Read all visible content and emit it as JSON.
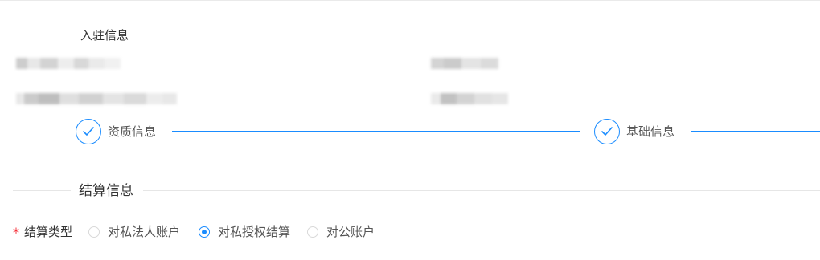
{
  "section_basic": {
    "title": "入驻信息"
  },
  "steps": [
    {
      "label": "资质信息",
      "state": "done",
      "icon": "check-icon"
    },
    {
      "label": "基础信息",
      "state": "done",
      "icon": "check-icon"
    }
  ],
  "section_settlement": {
    "title": "结算信息"
  },
  "settlement_type": {
    "required": true,
    "required_mark": "*",
    "label": "结算类型",
    "options": [
      {
        "label": "对私法人账户",
        "selected": false
      },
      {
        "label": "对私授权结算",
        "selected": true
      },
      {
        "label": "对公账户",
        "selected": false
      }
    ]
  },
  "colors": {
    "accent": "#1a8cff",
    "required": "#f5222d",
    "divider": "#e6e6e6"
  }
}
